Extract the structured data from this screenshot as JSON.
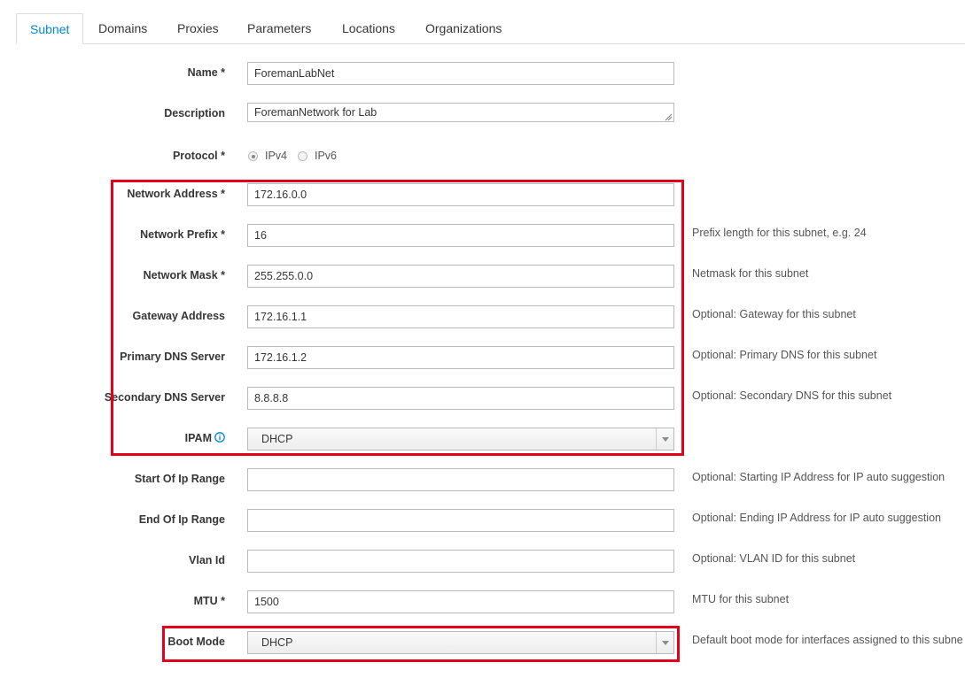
{
  "tabs": [
    {
      "label": "Subnet",
      "active": true
    },
    {
      "label": "Domains",
      "active": false
    },
    {
      "label": "Proxies",
      "active": false
    },
    {
      "label": "Parameters",
      "active": false
    },
    {
      "label": "Locations",
      "active": false
    },
    {
      "label": "Organizations",
      "active": false
    }
  ],
  "form": {
    "name": {
      "label": "Name *",
      "value": "ForemanLabNet"
    },
    "description": {
      "label": "Description",
      "value": "ForemanNetwork for Lab"
    },
    "protocol": {
      "label": "Protocol *",
      "options": [
        "IPv4",
        "IPv6"
      ],
      "selected": "IPv4"
    },
    "network_address": {
      "label": "Network Address *",
      "value": "172.16.0.0"
    },
    "network_prefix": {
      "label": "Network Prefix *",
      "value": "16",
      "help": "Prefix length for this subnet, e.g. 24"
    },
    "network_mask": {
      "label": "Network Mask *",
      "value": "255.255.0.0",
      "help": "Netmask for this subnet"
    },
    "gateway": {
      "label": "Gateway Address",
      "value": "172.16.1.1",
      "help": "Optional: Gateway for this subnet"
    },
    "primary_dns": {
      "label": "Primary DNS Server",
      "value": "172.16.1.2",
      "help": "Optional: Primary DNS for this subnet"
    },
    "secondary_dns": {
      "label": "Secondary DNS Server",
      "value": "8.8.8.8",
      "help": "Optional: Secondary DNS for this subnet"
    },
    "ipam": {
      "label": "IPAM",
      "value": "DHCP"
    },
    "start_ip": {
      "label": "Start Of Ip Range",
      "value": "",
      "help": "Optional: Starting IP Address for IP auto suggestion"
    },
    "end_ip": {
      "label": "End Of Ip Range",
      "value": "",
      "help": "Optional: Ending IP Address for IP auto suggestion"
    },
    "vlan": {
      "label": "Vlan Id",
      "value": "",
      "help": "Optional: VLAN ID for this subnet"
    },
    "mtu": {
      "label": "MTU *",
      "value": "1500",
      "help": "MTU for this subnet"
    },
    "boot_mode": {
      "label": "Boot Mode",
      "value": "DHCP",
      "help": "Default boot mode for interfaces assigned to this subne"
    }
  },
  "colors": {
    "accent": "#0088ce",
    "highlight": "#e2001a"
  }
}
